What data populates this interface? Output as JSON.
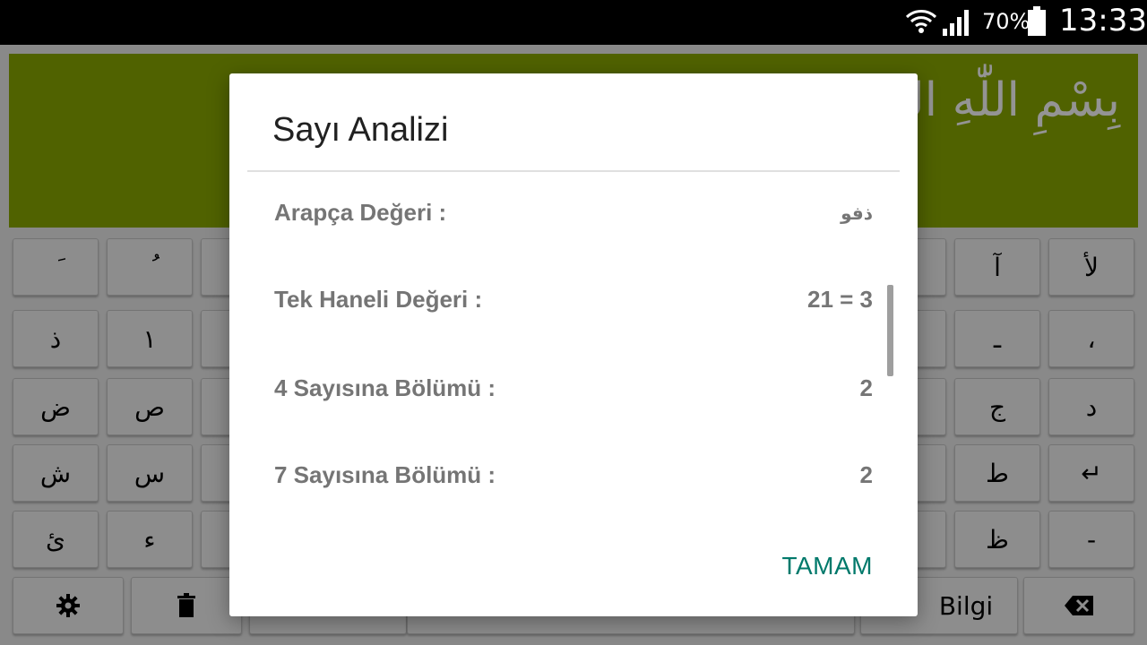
{
  "status_bar": {
    "battery_percent": "70%",
    "time": "13:33",
    "icons": [
      "wifi-icon",
      "signal-icon",
      "battery-icon"
    ]
  },
  "app": {
    "display_text": "بِسْمِ اللّٰهِ الرَّحْ",
    "display_color": "#8aaa00",
    "keys": {
      "r1c1": "َ",
      "r1c2": "ُ",
      "r1c10": "آ",
      "r1c11": "لأ",
      "r2c1": "ذ",
      "r2c2": "١",
      "r2c10": "ـ",
      "r2c11": "،",
      "r3c1": "ض",
      "r3c2": "ص",
      "r3c10": "ج",
      "r3c11": "د",
      "r4c1": "ش",
      "r4c2": "س",
      "r4c10": "ط",
      "r4c11": "↵",
      "r5c1": "ئ",
      "r5c2": "ء",
      "r5c10": "ظ",
      "r5c11": "-",
      "info_label": "Bilgi"
    }
  },
  "dialog": {
    "title": "Sayı Analizi",
    "rows": [
      {
        "label": "Arapça Değeri :",
        "value": "ذفو"
      },
      {
        "label": "Tek Haneli Değeri :",
        "value": "21 = 3"
      },
      {
        "label": "4 Sayısına Bölümü :",
        "value": "2"
      },
      {
        "label": "7 Sayısına Bölümü :",
        "value": "2"
      }
    ],
    "ok_label": "TAMAM",
    "accent_color": "#00796b"
  }
}
